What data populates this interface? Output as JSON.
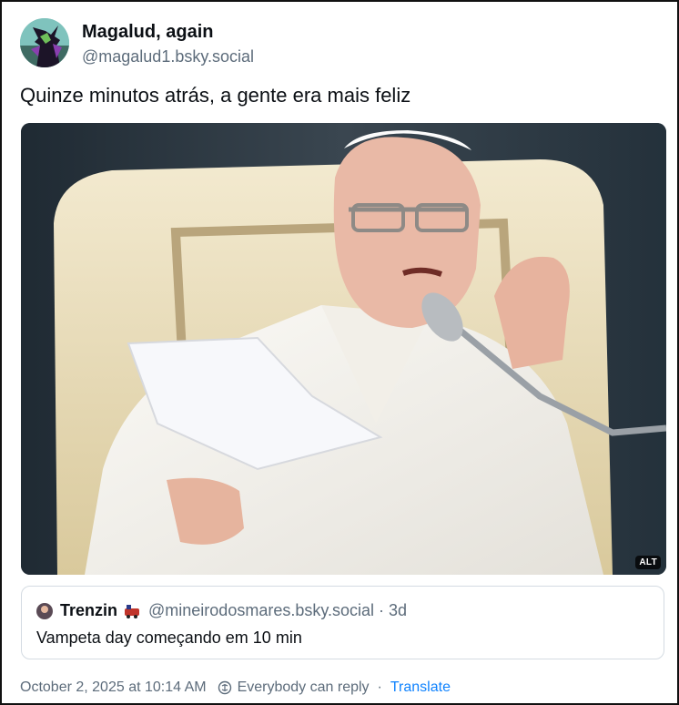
{
  "post": {
    "author": {
      "display_name": "Magalud, again",
      "handle": "@magalud1.bsky.social"
    },
    "text": "Quinze minutos atrás, a gente era mais feliz",
    "image": {
      "alt_badge": "ALT",
      "description_icon": "image-icon"
    },
    "quote": {
      "author_name": "Trenzin",
      "emoji_icon": "train-emoji-icon",
      "handle": "@mineirodosmares.bsky.social",
      "separator": "·",
      "time": "3d",
      "text": "Vampeta day começando em 10 min"
    },
    "footer": {
      "timestamp": "October 2, 2025 at 10:14 AM",
      "reply_setting": "Everybody can reply",
      "separator": "·",
      "translate_label": "Translate"
    }
  },
  "colors": {
    "text_primary": "#0b0f14",
    "text_secondary": "#5d6c7b",
    "link": "#1083fe",
    "border": "#d4dbe2"
  }
}
